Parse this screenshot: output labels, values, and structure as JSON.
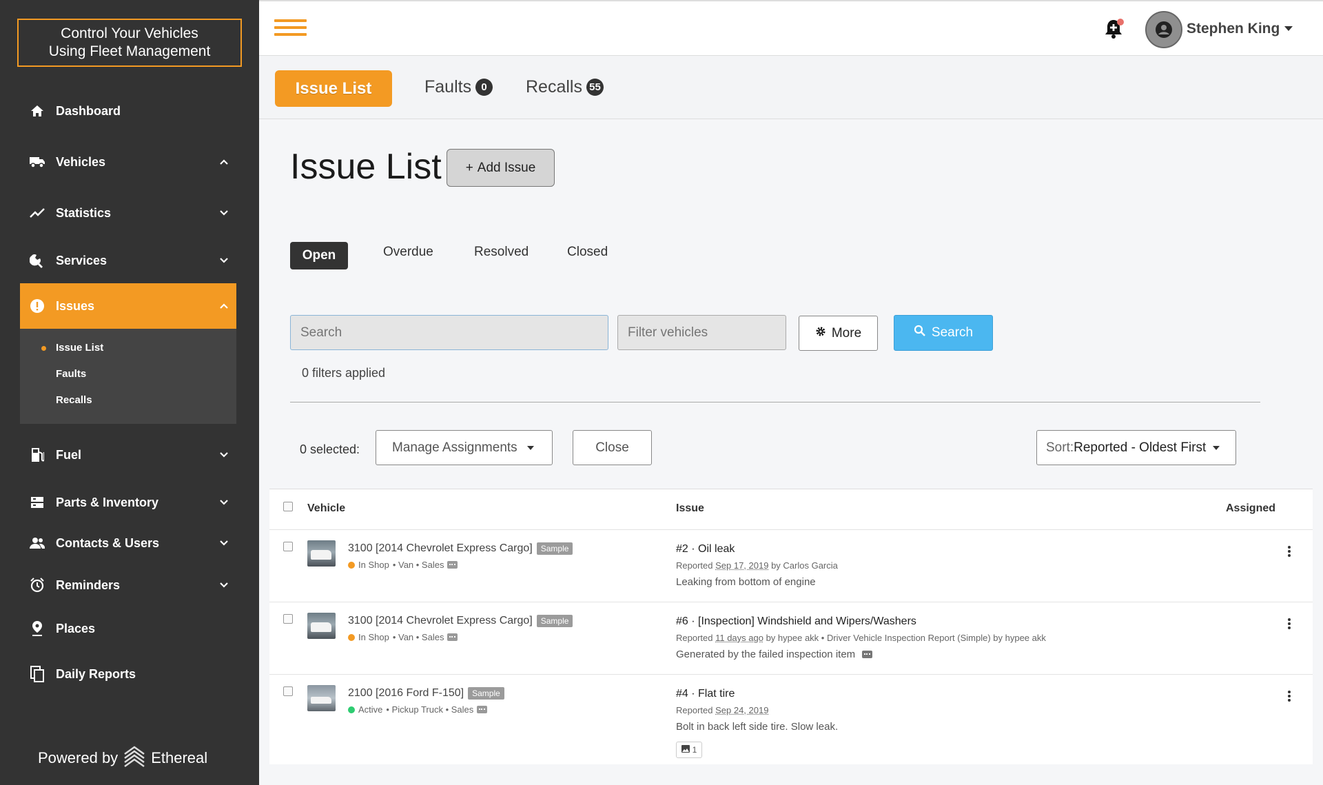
{
  "brand": {
    "line1": "Control Your Vehicles",
    "line2": "Using Fleet Management"
  },
  "sidebar": {
    "items": [
      {
        "label": "Dashboard",
        "icon": "home-icon"
      },
      {
        "label": "Vehicles",
        "icon": "truck-icon",
        "expanded": true
      },
      {
        "label": "Statistics",
        "icon": "chart-line-icon"
      },
      {
        "label": "Services",
        "icon": "wrench-icon"
      },
      {
        "label": "Issues",
        "icon": "alert-circle-icon",
        "active": true,
        "expanded": true
      },
      {
        "label": "Fuel",
        "icon": "fuel-pump-icon"
      },
      {
        "label": "Parts & Inventory",
        "icon": "inventory-icon"
      },
      {
        "label": "Contacts & Users",
        "icon": "users-icon"
      },
      {
        "label": "Reminders",
        "icon": "alarm-clock-icon"
      },
      {
        "label": "Places",
        "icon": "map-pin-icon"
      },
      {
        "label": "Daily Reports",
        "icon": "copy-document-icon"
      }
    ],
    "issues_submenu": [
      "Issue List",
      "Faults",
      "Recalls"
    ],
    "powered_by": "Powered by",
    "powered_brand": "Ethereal"
  },
  "header": {
    "user_name": "Stephen King"
  },
  "tabs": {
    "active": "Issue List",
    "faults_label": "Faults",
    "faults_count": "0",
    "recalls_label": "Recalls",
    "recalls_count": "55"
  },
  "main": {
    "title": "Issue List",
    "add_button": "Add Issue",
    "status_tabs": [
      "Open",
      "Overdue",
      "Resolved",
      "Closed"
    ],
    "search_placeholder": "Search",
    "filter_placeholder": "Filter vehicles",
    "more_button": "More",
    "search_button": "Search",
    "filters_applied": "0 filters applied",
    "selected_count": "0 selected:",
    "manage_assignments": "Manage Assignments",
    "close_button": "Close",
    "sort_prefix": "Sort:",
    "sort_value": "Reported - Oldest First"
  },
  "table": {
    "headers": {
      "vehicle": "Vehicle",
      "issue": "Issue",
      "assigned": "Assigned"
    },
    "rows": [
      {
        "vehicle": "3100 [2014 Chevrolet Express Cargo]",
        "sample": "Sample",
        "status": "In Shop",
        "status_color": "#f39a23",
        "meta": "• Van • Sales",
        "issue_title": "#2 · Oil leak",
        "reported_prefix": "Reported ",
        "reported_date": "Sep 17, 2019",
        "reported_suffix": " by Carlos Garcia",
        "description": "Leaking from bottom of engine"
      },
      {
        "vehicle": "3100 [2014 Chevrolet Express Cargo]",
        "sample": "Sample",
        "status": "In Shop",
        "status_color": "#f39a23",
        "meta": "• Van • Sales",
        "issue_title": "#6 · [Inspection] Windshield and Wipers/Washers",
        "reported_prefix": "Reported ",
        "reported_date": "11 days ago",
        "reported_suffix": " by hypee akk • Driver Vehicle Inspection Report (Simple) by hypee akk",
        "description": "Generated by the failed inspection item"
      },
      {
        "vehicle": "2100 [2016 Ford F-150]",
        "sample": "Sample",
        "status": "Active",
        "status_color": "#2ecc71",
        "meta": "• Pickup Truck • Sales",
        "issue_title": "#4 · Flat tire",
        "reported_prefix": "Reported ",
        "reported_date": "Sep 24, 2019",
        "reported_suffix": "",
        "description": "Bolt in back left side tire. Slow leak.",
        "photo_count": "1"
      }
    ]
  },
  "colors": {
    "accent": "#f39a23",
    "sidebar": "#333333",
    "search_button": "#4bb7f0"
  }
}
